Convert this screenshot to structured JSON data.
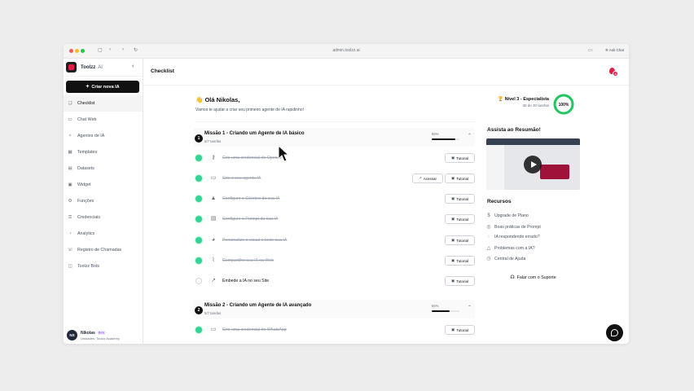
{
  "browser": {
    "url": "admin.toolzz.ai",
    "ask_chat": "Ask Chat"
  },
  "sidebar": {
    "brand": "Toolzz",
    "brand_suffix": "AI",
    "new_button": "Criar nova IA",
    "items": [
      {
        "label": "Checklist",
        "icon": "checklist-icon"
      },
      {
        "label": "Chat Web",
        "icon": "chat-icon"
      },
      {
        "label": "Agentes de IA",
        "icon": "agent-icon"
      },
      {
        "label": "Templates",
        "icon": "templates-icon"
      },
      {
        "label": "Datasets",
        "icon": "dataset-icon"
      },
      {
        "label": "Widget",
        "icon": "widget-icon"
      },
      {
        "label": "Funções",
        "icon": "function-icon"
      },
      {
        "label": "Credenciais",
        "icon": "key-icon"
      },
      {
        "label": "Analytics",
        "icon": "analytics-icon"
      },
      {
        "label": "Registro de Chamadas",
        "icon": "log-icon"
      },
      {
        "label": "Toolzz Bots",
        "icon": "bot-icon"
      }
    ],
    "user": {
      "initials": "NS",
      "name": "Nikolas",
      "badge": "Beta",
      "unit": "Unidades: Toolzz Academy"
    }
  },
  "header": {
    "title": "Checklist",
    "notifications": "4"
  },
  "greeting": {
    "title": "Olá Nikolas,",
    "emoji": "👋",
    "subtitle": "Vamos te ajudar a criar seu primeiro agente de IA rapidinho!"
  },
  "level": {
    "title": "Nível 3 - Especialista",
    "subtitle": "30 de 30 tarefas",
    "progress_label": "100%",
    "progress": 1.0
  },
  "missions": [
    {
      "number": "1",
      "title": "Missão 1 - Criando um Agente de IA básico",
      "subtitle": "6/7 tarefas",
      "percent": "85%",
      "progress": 0.85,
      "tasks": [
        {
          "label": "Crie uma credencial do OpenAI",
          "done": true,
          "icon": "key-icon",
          "buttons": [
            "Tutorial"
          ]
        },
        {
          "label": "Crie o seu agente IA",
          "done": true,
          "icon": "chat-icon",
          "buttons": [
            "Acessar",
            "Tutorial"
          ]
        },
        {
          "label": "Configure o Cérebro da sua IA",
          "done": true,
          "icon": "graduation-icon",
          "buttons": [
            "Tutorial"
          ]
        },
        {
          "label": "Configure o Prompt da sua IA",
          "done": true,
          "icon": "document-icon",
          "buttons": [
            "Tutorial"
          ]
        },
        {
          "label": "Personalize o visual e teste sua IA",
          "done": true,
          "icon": "palette-icon",
          "buttons": [
            "Tutorial"
          ]
        },
        {
          "label": "Compartilhe sua IA na Web",
          "done": true,
          "icon": "link-icon",
          "buttons": [
            "Tutorial"
          ]
        },
        {
          "label": "Embede a IA no seu Site",
          "done": false,
          "icon": "external-link-icon",
          "buttons": [
            "Tutorial"
          ]
        }
      ]
    },
    {
      "number": "2",
      "title": "Missão 2 - Criando um Agente de IA avançado",
      "subtitle": "5/7 tarefas",
      "percent": "66%",
      "progress": 0.66,
      "tasks": [
        {
          "label": "Crie uma credencial do WhatsApp",
          "done": true,
          "icon": "chat-icon",
          "buttons": [
            "Tutorial"
          ]
        }
      ]
    }
  ],
  "right_panel": {
    "video_title": "Assista ao Resumão!",
    "resources_title": "Recursos",
    "resources": [
      {
        "label": "Upgrade de Plano",
        "icon": "dollar-icon"
      },
      {
        "label": "Boas práticas de Prompt",
        "icon": "tips-icon"
      },
      {
        "label": "IA respondendo errado?",
        "icon": "message-icon"
      },
      {
        "label": "Problemas com a IA?",
        "icon": "warning-icon"
      },
      {
        "label": "Central de Ajuda",
        "icon": "help-icon"
      }
    ],
    "support_button": "Falar com o Suporte"
  },
  "colors": {
    "brand": "#e11d48",
    "success": "#22c55e",
    "primary": "#111111"
  }
}
